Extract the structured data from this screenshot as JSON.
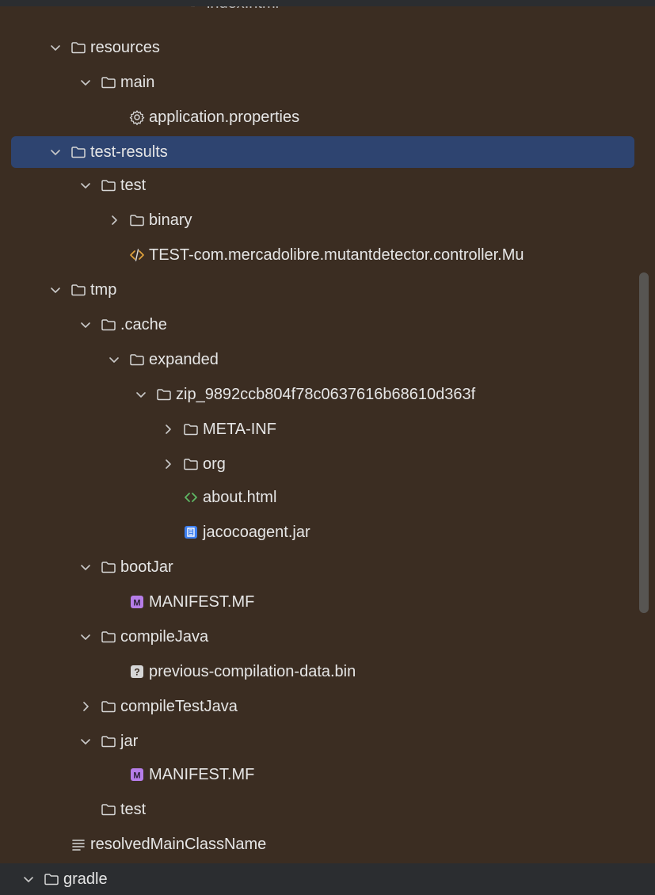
{
  "tree": {
    "top_partial": "<> index.html",
    "items": [
      {
        "label": "resources",
        "icon": "folder-icon",
        "expanded": true
      },
      {
        "label": "main",
        "icon": "folder-icon",
        "expanded": true
      },
      {
        "label": "application.properties",
        "icon": "gear-icon"
      },
      {
        "label": "test-results",
        "icon": "folder-icon",
        "expanded": true,
        "selected": true
      },
      {
        "label": "test",
        "icon": "folder-icon",
        "expanded": true
      },
      {
        "label": "binary",
        "icon": "folder-icon",
        "expanded": false
      },
      {
        "label": "TEST-com.mercadolibre.mutantdetector.controller.Mu",
        "icon": "xml-icon"
      },
      {
        "label": "tmp",
        "icon": "folder-icon",
        "expanded": true
      },
      {
        "label": ".cache",
        "icon": "folder-icon",
        "expanded": true
      },
      {
        "label": "expanded",
        "icon": "folder-icon",
        "expanded": true
      },
      {
        "label": "zip_9892ccb804f78c0637616b68610d363f",
        "icon": "folder-icon",
        "expanded": true
      },
      {
        "label": "META-INF",
        "icon": "folder-icon",
        "expanded": false
      },
      {
        "label": "org",
        "icon": "folder-icon",
        "expanded": false
      },
      {
        "label": "about.html",
        "icon": "html-icon"
      },
      {
        "label": "jacocoagent.jar",
        "icon": "jar-icon"
      },
      {
        "label": "bootJar",
        "icon": "folder-icon",
        "expanded": true
      },
      {
        "label": "MANIFEST.MF",
        "icon": "manifest-icon"
      },
      {
        "label": "compileJava",
        "icon": "folder-icon",
        "expanded": true
      },
      {
        "label": "previous-compilation-data.bin",
        "icon": "unknown-file-icon"
      },
      {
        "label": "compileTestJava",
        "icon": "folder-icon",
        "expanded": false
      },
      {
        "label": "jar",
        "icon": "folder-icon",
        "expanded": true
      },
      {
        "label": "MANIFEST.MF",
        "icon": "manifest-icon"
      },
      {
        "label": "test",
        "icon": "folder-icon"
      },
      {
        "label": "resolvedMainClassName",
        "icon": "text-file-icon"
      },
      {
        "label": "gradle",
        "icon": "folder-icon",
        "expanded": true
      }
    ]
  },
  "colors": {
    "background": "#3b2d22",
    "selection": "#2e4470",
    "text": "#e6e6e6",
    "html_icon": "#5fb865",
    "jar_icon": "#3d7ff0",
    "manifest_icon": "#b67de8"
  }
}
